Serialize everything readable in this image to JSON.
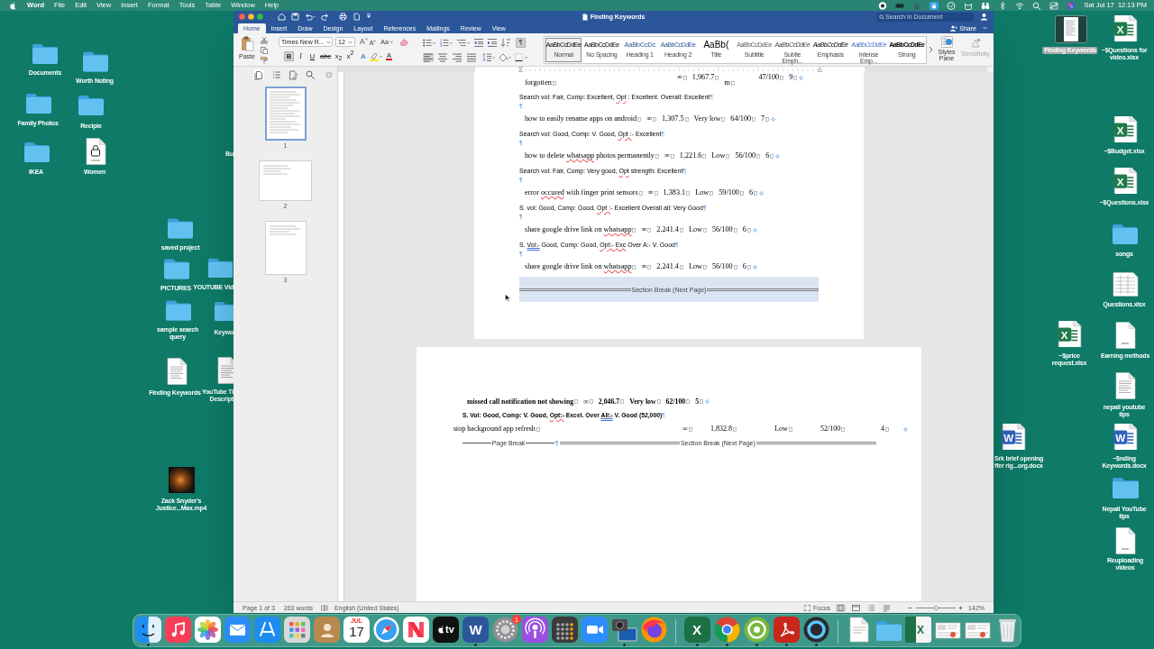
{
  "menu_bar": {
    "app_name": "Word",
    "menus": [
      "File",
      "Edit",
      "View",
      "Insert",
      "Format",
      "Tools",
      "Table",
      "Window",
      "Help"
    ],
    "clock": "Sat Jul 17  12:13 PM"
  },
  "desktop_icons": [
    {
      "lines": [
        "Documents"
      ],
      "kind": "folder",
      "selected": false
    },
    {
      "lines": [
        "Worth Noting"
      ],
      "kind": "folder",
      "selected": false
    },
    {
      "lines": [
        "Family Photos"
      ],
      "kind": "folder",
      "selected": false
    },
    {
      "lines": [
        "Recipie"
      ],
      "kind": "folder",
      "selected": false
    },
    {
      "lines": [
        "IKEA"
      ],
      "kind": "folder",
      "selected": false
    },
    {
      "lines": [
        "Women"
      ],
      "kind": "locked-doc",
      "selected": false
    },
    {
      "lines": [
        "Bu"
      ],
      "kind": "none",
      "selected": false
    },
    {
      "lines": [
        "saved project"
      ],
      "kind": "folder",
      "selected": false
    },
    {
      "lines": [
        "PICTURES"
      ],
      "kind": "folder",
      "selected": false
    },
    {
      "lines": [
        "YOUTUBE Vid"
      ],
      "kind": "folder",
      "selected": false
    },
    {
      "lines": [
        "sample search",
        "query"
      ],
      "kind": "folder",
      "selected": false
    },
    {
      "lines": [
        "Keywo"
      ],
      "kind": "folder",
      "selected": false
    },
    {
      "lines": [
        "Finding Keywords"
      ],
      "kind": "text-doc",
      "selected": false
    },
    {
      "lines": [
        "YouTube Ti",
        "Descript"
      ],
      "kind": "text-doc",
      "selected": false
    },
    {
      "lines": [
        "Zack Snyder's",
        "Justice...Max.mp4"
      ],
      "kind": "video",
      "selected": false
    },
    {
      "lines": [
        "Finding Keywords"
      ],
      "kind": "doc-preview",
      "selected": true
    },
    {
      "lines": [
        "~$Questions for",
        "video.xlsx"
      ],
      "kind": "xlsx",
      "glyph": "X",
      "selected": false
    },
    {
      "lines": [
        "~$Budget.xlsx"
      ],
      "kind": "xlsx",
      "glyph": "X",
      "selected": false
    },
    {
      "lines": [
        "~$Questions.xlsx"
      ],
      "kind": "xlsx",
      "glyph": "X",
      "selected": false
    },
    {
      "lines": [
        "songs"
      ],
      "kind": "folder",
      "selected": false
    },
    {
      "lines": [
        "Questions.xlsx"
      ],
      "kind": "sheet-preview",
      "selected": false
    },
    {
      "lines": [
        "~$price",
        "request.xlsx"
      ],
      "kind": "xlsx",
      "glyph": "X",
      "selected": false
    },
    {
      "lines": [
        "Earning methods"
      ],
      "kind": "blank-doc",
      "selected": false
    },
    {
      "lines": [
        "nepali youtube",
        "tips"
      ],
      "kind": "text-doc",
      "selected": false
    },
    {
      "lines": [
        "Srk brief opening",
        "ffer rig...org.docx"
      ],
      "kind": "docx",
      "glyph": "W",
      "selected": false
    },
    {
      "lines": [
        "~$nding",
        "Keywords.docx"
      ],
      "kind": "docx",
      "glyph": "W",
      "selected": false
    },
    {
      "lines": [
        "Nepali YouTube",
        "tips"
      ],
      "kind": "folder",
      "selected": false
    },
    {
      "lines": [
        "Reuploading",
        "videos"
      ],
      "kind": "blank-doc",
      "selected": false
    }
  ],
  "window": {
    "title": "Finding Keywords",
    "quick_access": [
      {
        "kind": "home"
      },
      {
        "kind": "save"
      },
      {
        "kind": "undo"
      },
      {
        "kind": "redo"
      },
      {
        "kind": "print"
      },
      {
        "kind": "new"
      },
      {
        "kind": "customize"
      }
    ],
    "search": {
      "placeholder": "Search in Document"
    }
  },
  "tabs": [
    {
      "label": "Home",
      "selected": true
    },
    {
      "label": "Insert",
      "selected": false
    },
    {
      "label": "Draw",
      "selected": false
    },
    {
      "label": "Design",
      "selected": false
    },
    {
      "label": "Layout",
      "selected": false
    },
    {
      "label": "References",
      "selected": false
    },
    {
      "label": "Mailings",
      "selected": false
    },
    {
      "label": "Review",
      "selected": false
    },
    {
      "label": "View",
      "selected": false
    }
  ],
  "share": {
    "label": "Share"
  },
  "ribbon": {
    "paste": {
      "label": "Paste"
    },
    "clipboard_tools": [
      {
        "kind": "cut"
      },
      {
        "kind": "copy"
      },
      {
        "kind": "format-painter"
      }
    ],
    "font_name": "Times New R...",
    "font_size": "12",
    "font_tools": [
      {
        "kind": "grow",
        "label": "A"
      },
      {
        "kind": "shrink",
        "label": "A"
      },
      {
        "kind": "case",
        "label": "Aa"
      },
      {
        "kind": "clear"
      }
    ],
    "format_toggles": [
      {
        "label": "B",
        "on": true
      },
      {
        "label": "I",
        "on": false
      },
      {
        "label": "U",
        "on": false
      },
      {
        "label": "abc",
        "on": false
      },
      {
        "label": "x$_{2}$",
        "on": false
      },
      {
        "label": "x$^{2}$",
        "on": false
      }
    ],
    "color_tools": [
      {
        "kind": "effects",
        "label": "A"
      },
      {
        "kind": "highlight"
      },
      {
        "kind": "font-color",
        "label": "A"
      }
    ],
    "list_tools": [
      {
        "kind": "bullets"
      },
      {
        "kind": "numbering"
      },
      {
        "kind": "multilevel"
      },
      {
        "kind": "outdent"
      },
      {
        "kind": "indent"
      },
      {
        "kind": "sort"
      }
    ],
    "show_marks": {
      "label": "¶",
      "on": true
    },
    "alignment": [
      {
        "kind": "left",
        "selected": true
      },
      {
        "kind": "center",
        "selected": false
      },
      {
        "kind": "right",
        "selected": false
      },
      {
        "kind": "justify",
        "selected": false
      }
    ],
    "para_tools": [
      {
        "kind": "line-spacing"
      },
      {
        "kind": "shading"
      },
      {
        "kind": "borders"
      }
    ],
    "styles": [
      {
        "preview": "AaBbCcDdEe",
        "name": "Normal",
        "kind": "normal",
        "selected": true
      },
      {
        "preview": "AaBbCcDdEe",
        "name": "No Spacing",
        "kind": "no-spacing",
        "selected": false
      },
      {
        "preview": "AaBbCcDc",
        "name": "Heading 1",
        "kind": "heading-1",
        "selected": false
      },
      {
        "preview": "AaBbCcDdEe",
        "name": "Heading 2",
        "kind": "heading-2",
        "selected": false
      },
      {
        "preview": "AaBb(",
        "name": "Title",
        "kind": "title",
        "selected": false
      },
      {
        "preview": "AaBbCcDdEe",
        "name": "Subtitle",
        "kind": "subtitle",
        "selected": false
      },
      {
        "preview": "AaBbCcDdEe",
        "name": "Subtle Emph...",
        "kind": "subtle-emphasis",
        "selected": false
      },
      {
        "preview": "AaBbCcDdEe",
        "name": "Emphasis",
        "kind": "emphasis",
        "selected": false
      },
      {
        "preview": "AaBbCcDdEe",
        "name": "Intense Emp...",
        "kind": "intense-emphasis",
        "selected": false
      },
      {
        "preview": "AaBbCcDdEe",
        "name": "Strong",
        "kind": "strong",
        "selected": false
      }
    ],
    "styles_pane": {
      "label": "Styles Pane"
    },
    "sensitivity": {
      "label": "Sensitivity",
      "disabled": true
    }
  },
  "nav_pane": {
    "tabs": [
      {
        "kind": "thumbnails",
        "selected": true
      },
      {
        "kind": "outline",
        "selected": false
      },
      {
        "kind": "changes",
        "selected": false
      },
      {
        "kind": "search",
        "selected": false
      }
    ],
    "thumbnails": [
      {
        "page": "1",
        "kind": "portrait",
        "selected": true
      },
      {
        "page": "2",
        "kind": "landscape",
        "selected": false
      },
      {
        "page": "3",
        "kind": "portrait",
        "selected": false
      }
    ]
  },
  "document": {
    "pages": [
      {
        "kind": "portrait",
        "blocks": [
          {
            "kind": "wrapped-row",
            "bold": false,
            "keyword": [
              {
                "text": "forgotten",
                "kind": "plain"
              }
            ],
            "values": [
              "∞",
              "1,967.7",
              "m",
              "47/100",
              "9"
            ]
          },
          {
            "kind": "para",
            "bold": false,
            "runs": [
              {
                "text": "Search vol: Fair, Comp: Excellent, ",
                "kind": "plain"
              },
              {
                "text": "Opt",
                "kind": "misspelled"
              },
              {
                "text": " : Excellent. Overall: Excellent",
                "kind": "plain"
              }
            ],
            "mark": "¶"
          },
          {
            "kind": "empty",
            "mark": "¶"
          },
          {
            "kind": "row",
            "bold": false,
            "keyword": [
              {
                "text": "how to easily rename apps on android",
                "kind": "plain"
              }
            ],
            "values": [
              "∞",
              "1,307.5",
              "Very low",
              "64/100",
              "7"
            ]
          },
          {
            "kind": "para",
            "bold": false,
            "runs": [
              {
                "text": "Search vol: Good, Comp: V. Good, ",
                "kind": "plain"
              },
              {
                "text": "Opt :",
                "kind": "misspelled"
              },
              {
                "text": "- Excellent",
                "kind": "plain"
              }
            ],
            "mark": "¶"
          },
          {
            "kind": "empty",
            "mark": "¶"
          },
          {
            "kind": "row",
            "bold": false,
            "keyword": [
              {
                "text": "how to delete ",
                "kind": "plain"
              },
              {
                "text": "whatsapp",
                "kind": "misspelled"
              },
              {
                "text": " photos permanently",
                "kind": "plain"
              }
            ],
            "values": [
              "∞",
              "1,221.6",
              "Low",
              "56/100",
              "6"
            ]
          },
          {
            "kind": "para",
            "bold": false,
            "runs": [
              {
                "text": "Search vol: Fair, Comp: Very good, ",
                "kind": "plain"
              },
              {
                "text": "Opt",
                "kind": "misspelled"
              },
              {
                "text": " strength: Excellent",
                "kind": "plain"
              }
            ],
            "mark": "¶"
          },
          {
            "kind": "empty",
            "mark": "¶"
          },
          {
            "kind": "row",
            "bold": false,
            "keyword": [
              {
                "text": "error ",
                "kind": "plain"
              },
              {
                "text": "occured",
                "kind": "misspelled"
              },
              {
                "text": " with finger print sensors",
                "kind": "plain"
              }
            ],
            "values": [
              "∞",
              "1,383.1",
              "Low",
              "59/100",
              "6"
            ]
          },
          {
            "kind": "para",
            "bold": false,
            "runs": [
              {
                "text": "S. vol: Good, Comp: Good, ",
                "kind": "plain"
              },
              {
                "text": "Opt :",
                "kind": "misspelled"
              },
              {
                "text": "- Excellent Overall all: Very Good",
                "kind": "plain"
              }
            ],
            "mark": "¶"
          },
          {
            "kind": "empty",
            "mark": "¶"
          },
          {
            "kind": "row",
            "bold": false,
            "keyword": [
              {
                "text": "share google drive link on ",
                "kind": "plain"
              },
              {
                "text": "whatsapp",
                "kind": "misspelled"
              }
            ],
            "values": [
              "∞",
              "2,241.4",
              "Low",
              "56/100",
              "6"
            ]
          },
          {
            "kind": "para",
            "bold": false,
            "runs": [
              {
                "text": "S. ",
                "kind": "plain"
              },
              {
                "text": "Vol:-",
                "kind": "grammar"
              },
              {
                "text": " Good, Comp: Good, ",
                "kind": "plain"
              },
              {
                "text": "Opt:- Exc",
                "kind": "misspelled"
              },
              {
                "text": " Over A:- V. Good",
                "kind": "plain"
              }
            ],
            "mark": "¶"
          },
          {
            "kind": "empty",
            "mark": "¶"
          },
          {
            "kind": "row",
            "bold": false,
            "keyword": [
              {
                "text": "share google drive link on ",
                "kind": "plain"
              },
              {
                "text": "whatsapp",
                "kind": "misspelled"
              }
            ],
            "values": [
              "∞",
              "2,241.4",
              "Low",
              "56/100",
              "6"
            ]
          },
          {
            "kind": "section-break",
            "label": "Section Break (Next Page)",
            "selected": true
          }
        ]
      },
      {
        "kind": "landscape",
        "blocks": [
          {
            "kind": "row",
            "bold": true,
            "keyword": [
              {
                "text": "missed call notification not showing",
                "kind": "plain"
              }
            ],
            "values": [
              "∞",
              "2,046.7",
              "Very low",
              "62/100",
              "5"
            ]
          },
          {
            "kind": "para",
            "bold": true,
            "runs": [
              {
                "text": "S. Vol: Good, Comp: V. Good, ",
                "kind": "plain"
              },
              {
                "text": "Opt:-",
                "kind": "misspelled"
              },
              {
                "text": " Excel. Over ",
                "kind": "plain"
              },
              {
                "text": "All:-",
                "kind": "grammar"
              },
              {
                "text": " V. Good (52,000)",
                "kind": "plain"
              }
            ],
            "mark": "¶"
          },
          {
            "kind": "spread-row",
            "bold": false,
            "keyword": [
              {
                "text": "stop background app refresh",
                "kind": "plain"
              }
            ],
            "values": [
              "∞",
              "1,832.8",
              "Low",
              "52/100",
              "4"
            ]
          },
          {
            "kind": "page-break",
            "label": "Page Break",
            "mark": "¶",
            "section_label": "Section Break (Next Page)"
          }
        ]
      }
    ]
  },
  "status_bar": {
    "page": "Page 1 of 3",
    "words": "263 words",
    "language": "English (United States)",
    "focus": "Focus",
    "views": [
      {
        "kind": "print-layout",
        "selected": true
      },
      {
        "kind": "web-layout",
        "selected": false
      },
      {
        "kind": "outline",
        "selected": false
      },
      {
        "kind": "draft",
        "selected": false
      }
    ],
    "zoom": {
      "level": 0.52,
      "reading": "142%"
    }
  },
  "dock": {
    "apps": [
      {
        "kind": "finder",
        "running": true
      },
      {
        "kind": "music",
        "running": false
      },
      {
        "kind": "photos",
        "running": false
      },
      {
        "kind": "mail",
        "running": false
      },
      {
        "kind": "app-store",
        "running": false
      },
      {
        "kind": "launchpad",
        "running": false
      },
      {
        "kind": "contacts",
        "running": false
      },
      {
        "kind": "calendar",
        "month": "JUL",
        "day": "17",
        "running": false
      },
      {
        "kind": "safari",
        "running": false
      },
      {
        "kind": "news",
        "running": false
      },
      {
        "kind": "tv",
        "glyph": "tv",
        "running": false
      },
      {
        "kind": "word",
        "glyph": "W",
        "running": true
      },
      {
        "kind": "settings",
        "badge": "1",
        "running": false
      },
      {
        "kind": "podcasts",
        "running": false
      },
      {
        "kind": "calculator",
        "running": false
      },
      {
        "kind": "zoom",
        "running": false
      },
      {
        "kind": "image-capture",
        "running": true
      },
      {
        "kind": "firefox",
        "running": false
      }
    ],
    "pinned": [
      {
        "kind": "excel",
        "glyph": "X",
        "running": true
      },
      {
        "kind": "chrome",
        "running": true
      },
      {
        "kind": "utorrent",
        "running": true
      },
      {
        "kind": "acrobat",
        "running": true
      },
      {
        "kind": "quicktime",
        "running": true
      }
    ],
    "stacks": [
      {
        "kind": "doc"
      },
      {
        "kind": "folder"
      },
      {
        "kind": "xlsx",
        "glyph": "X"
      },
      {
        "kind": "screenshot"
      },
      {
        "kind": "screenshot"
      },
      {
        "kind": "trash"
      }
    ]
  }
}
